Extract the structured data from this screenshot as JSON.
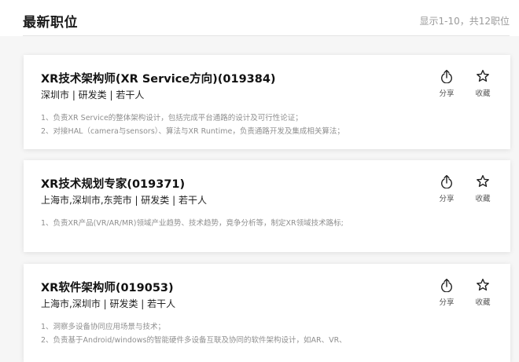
{
  "header": {
    "title": "最新职位",
    "count_text": "显示1-10，共12职位"
  },
  "actions": {
    "share_label": "分享",
    "favorite_label": "收藏"
  },
  "jobs": [
    {
      "title": "XR技术架构师(XR Service方向)(019384)",
      "meta": "深圳市 | 研发类 | 若干人",
      "description": [
        "1、负责XR Service的整体架构设计，包括完成平台通路的设计及可行性论证；",
        "2、对接HAL（camera与sensors）、算法与XR Runtime，负责通路开发及集成相关算法；"
      ]
    },
    {
      "title": "XR技术规划专家(019371)",
      "meta": "上海市,深圳市,东莞市 | 研发类 | 若干人",
      "description": [
        "1、负责XR产品(VR/AR/MR)领域产业趋势、技术趋势，竟争分析等，制定XR领域技术路标;"
      ]
    },
    {
      "title": "XR软件架构师(019053)",
      "meta": "上海市,深圳市 | 研发类 | 若干人",
      "description": [
        "1、洞察多设备协同应用场景与技术；",
        "2、负责基于Android/windows的智能硬件多设备互联及协同的软件架构设计，如AR、VR、"
      ]
    }
  ],
  "colors": {
    "background": "#f6f6f6",
    "card": "#ffffff",
    "muted_text": "#8f8f8f",
    "count_text": "#9a9a9a"
  },
  "icons": {
    "share": "share-icon",
    "favorite": "star-icon"
  }
}
